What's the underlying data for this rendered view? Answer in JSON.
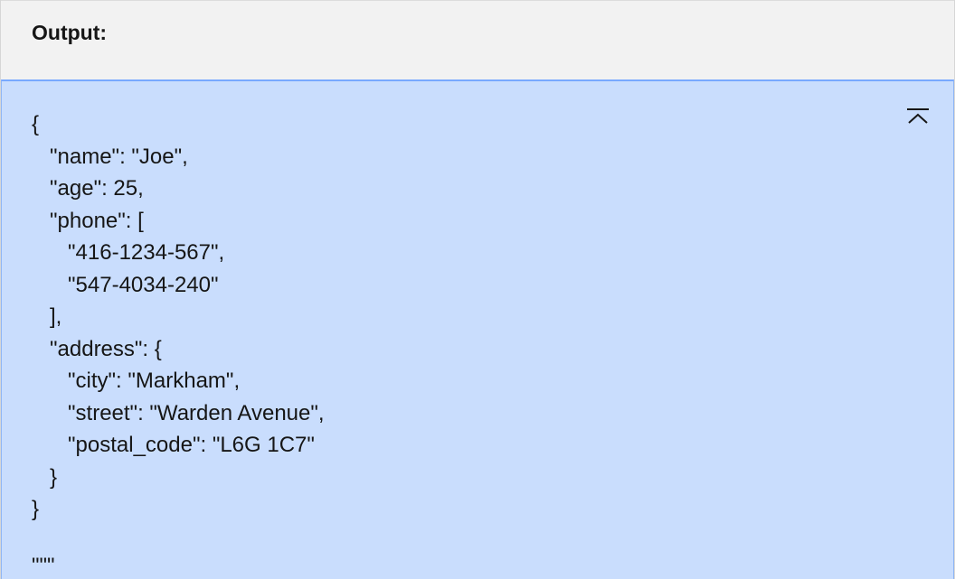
{
  "header": {
    "label": "Output:"
  },
  "output": {
    "collapse_icon": "collapse-up-icon",
    "lines": [
      "{",
      "   \"name\": \"Joe\",",
      "   \"age\": 25,",
      "   \"phone\": [",
      "      \"416-1234-567\",",
      "      \"547-4034-240\"",
      "   ],",
      "   \"address\": {",
      "      \"city\": \"Markham\",",
      "      \"street\": \"Warden Avenue\",",
      "      \"postal_code\": \"L6G 1C7\"",
      "   }",
      "}",
      "",
      "\"\"\""
    ]
  }
}
